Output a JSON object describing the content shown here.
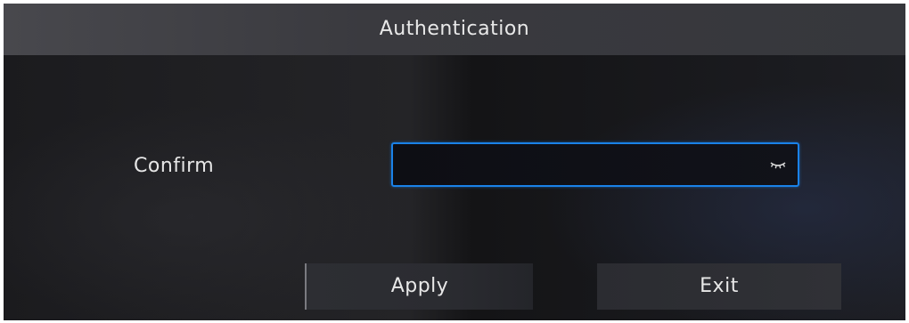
{
  "dialog": {
    "title": "Authentication",
    "confirm_label": "Confirm",
    "password_value": "",
    "password_icon": "hidden-password-icon",
    "apply_label": "Apply",
    "exit_label": "Exit"
  },
  "colors": {
    "accent": "#1a82e8",
    "titlebar": "#3e3e43",
    "text": "#e6e6e6"
  }
}
